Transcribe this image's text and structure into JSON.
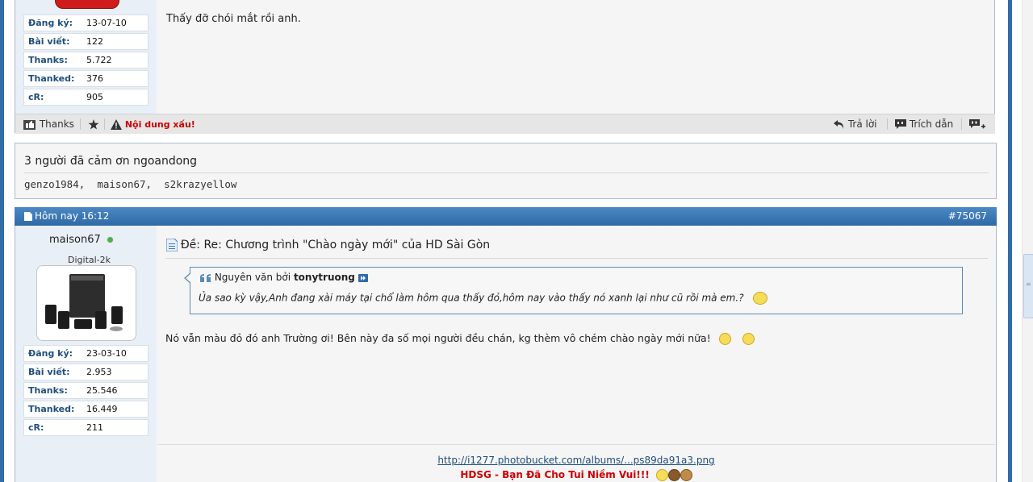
{
  "post1": {
    "stats": [
      {
        "label": "Đăng ký:",
        "value": "13-07-10"
      },
      {
        "label": "Bài viết:",
        "value": "122"
      },
      {
        "label": "Thanks:",
        "value": "5.722"
      },
      {
        "label": "Thanked:",
        "value": "376"
      },
      {
        "label": "cR:",
        "value": "905"
      }
    ],
    "message": "Thấy đỡ chói mắt rồi anh.",
    "footer": {
      "thanks_label": "Thanks",
      "report_label": "Nội dung xấu!",
      "reply_label": "Trả lời",
      "quote_label": "Trích dẫn"
    }
  },
  "thanks_box": {
    "title": "3 người đã cảm ơn ngoandong",
    "names": [
      "genzo1984",
      "maison67",
      "s2krazyellow"
    ],
    "separator": ","
  },
  "post2": {
    "date": "Hôm nay 16:12",
    "number": "#75067",
    "username": "maison67",
    "user_title": "Digital-2k",
    "stats": [
      {
        "label": "Đăng ký:",
        "value": "23-03-10"
      },
      {
        "label": "Bài viết:",
        "value": "2.953"
      },
      {
        "label": "Thanks:",
        "value": "25.546"
      },
      {
        "label": "Thanked:",
        "value": "16.449"
      },
      {
        "label": "cR:",
        "value": "211"
      }
    ],
    "title": "Đề: Re: Chương trình \"Chào ngày mới\" của HD Sài Gòn",
    "quote": {
      "prefix": "Nguyên văn bởi",
      "author": "tonytruong",
      "text": "Ủa sao kỳ vậy,Anh đang xài máy tại chổ làm hôm qua thấy đỏ,hôm nay vào thấy nó xanh lại như cũ rồi mà em.?"
    },
    "message": "Nó vẫn màu đỏ đó anh Trường ơi! Bên này đa số mọi người đều chán, kg thèm vô chém chào ngày mới nữa!",
    "signature": {
      "link": "http://i1277.photobucket.com/albums/...ps89da91a3.png",
      "slogan": "HDSG - Bạn Đã Cho Tui Niềm Vui!!!"
    }
  },
  "colors": {
    "header_blue": "#3a79b8",
    "label_blue": "#1f4e7d",
    "report_red": "#cc0000",
    "online_green": "#4caf50"
  }
}
